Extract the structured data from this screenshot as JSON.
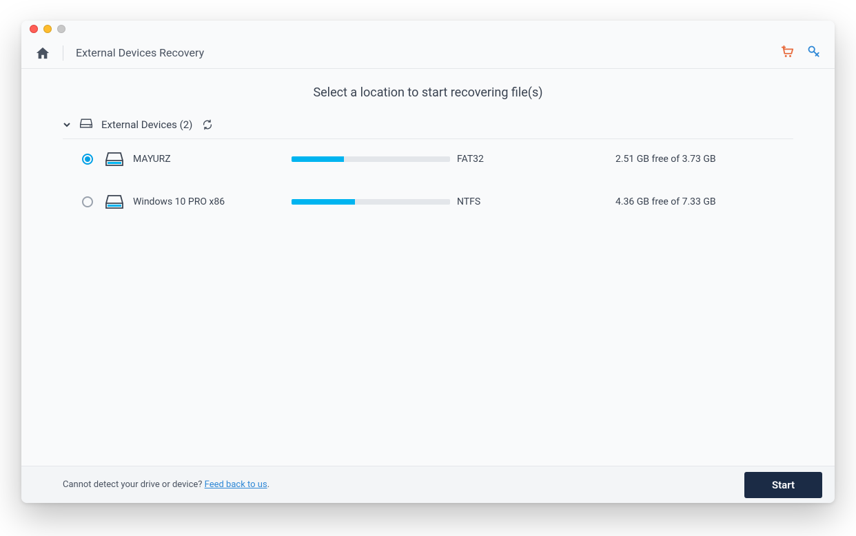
{
  "toolbar": {
    "title": "External Devices Recovery"
  },
  "heading": "Select a location to start recovering file(s)",
  "group": {
    "label": "External Devices (2)"
  },
  "devices": [
    {
      "name": "MAYURZ",
      "fs": "FAT32",
      "free_text": "2.51 GB free of 3.73 GB",
      "used_pct": 33,
      "selected": true
    },
    {
      "name": "Windows 10 PRO x86",
      "fs": "NTFS",
      "free_text": "4.36 GB free of 7.33 GB",
      "used_pct": 40,
      "selected": false
    }
  ],
  "footer": {
    "text": "Cannot detect your drive or device? ",
    "link": "Feed back to us",
    "period": ".",
    "start_label": "Start"
  },
  "colors": {
    "accent": "#00b4f0",
    "cart": "#e76a3c",
    "key": "#2f88d6"
  }
}
